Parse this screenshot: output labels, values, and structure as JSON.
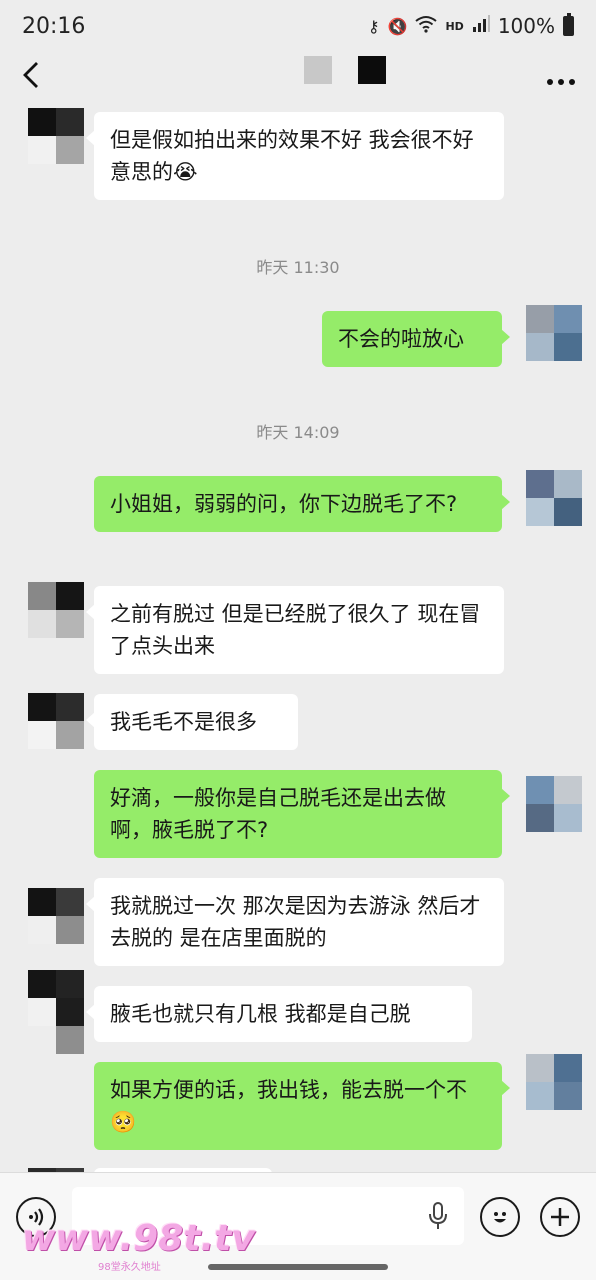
{
  "status_bar": {
    "time": "20:16",
    "icons": [
      "key-icon",
      "mute-icon",
      "wifi-icon",
      "hd-icon",
      "signal-icon"
    ],
    "hd": "HD",
    "battery": "100%"
  },
  "nav": {
    "back_icon": "chevron-left-icon",
    "more_icon": "more-dots-icon"
  },
  "messages": [
    {
      "side": "in",
      "text": "但是假如拍出来的效果不好 我会很不好意思的",
      "emoji": "😭"
    },
    {
      "type": "time",
      "text": "昨天 11:30"
    },
    {
      "side": "out",
      "text": "不会的啦放心"
    },
    {
      "type": "time",
      "text": "昨天 14:09"
    },
    {
      "side": "out",
      "text": "小姐姐，弱弱的问，你下边脱毛了不?"
    },
    {
      "side": "in",
      "text": "之前有脱过 但是已经脱了很久了 现在冒了点头出来"
    },
    {
      "side": "in",
      "text": "我毛毛不是很多"
    },
    {
      "side": "out",
      "text": "好滴，一般你是自己脱毛还是出去做啊，腋毛脱了不?"
    },
    {
      "side": "in",
      "text": "我就脱过一次 那次是因为去游泳 然后才去脱的 是在店里面脱的"
    },
    {
      "side": "in",
      "text": "腋毛也就只有几根 我都是自己脱"
    },
    {
      "side": "out",
      "text": "如果方便的话，我出钱，能去脱一个不",
      "emoji": "🥺"
    }
  ],
  "input_bar": {
    "voice_icon": "voice-icon",
    "mic_icon": "mic-icon",
    "emoji_icon": "emoji-icon",
    "plus_icon": "plus-icon",
    "placeholder": ""
  },
  "watermark": {
    "text": "www.98t.tv",
    "sub": "98堂永久地址"
  },
  "colors": {
    "background": "#ededed",
    "incoming_bubble": "#ffffff",
    "outgoing_bubble": "#95ec69",
    "timestamp": "#8a8a8a"
  }
}
